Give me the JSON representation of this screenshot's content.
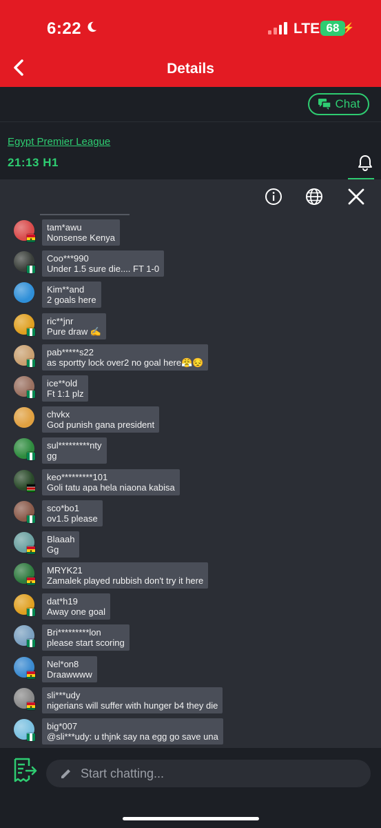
{
  "status_bar": {
    "time": "6:22",
    "network": "LTE",
    "battery": "68"
  },
  "nav": {
    "title": "Details"
  },
  "chat_button": {
    "label": "Chat"
  },
  "match": {
    "league": "Egypt Premier League",
    "time_status": "21:13 H1"
  },
  "messages": [
    {
      "name": "tam*awu",
      "text": "Nonsense Kenya",
      "avatar_color": "#d94a4a",
      "flag": "ghana"
    },
    {
      "name": "Coo***990",
      "text": "Under 1.5 sure die.... FT 1-0",
      "avatar_color": "#3a3f3a",
      "flag": "nigeria"
    },
    {
      "name": "Kim**and",
      "text": "2 goals here",
      "avatar_color": "#2f8fd8",
      "flag": "none"
    },
    {
      "name": "ric**jnr",
      "text": "Pure draw ✍",
      "avatar_color": "#e0a020",
      "flag": "nigeria"
    },
    {
      "name": "pab*****s22",
      "text": "as sportty lock over2 no goal here😤😔",
      "avatar_color": "#c9a070",
      "flag": "nigeria"
    },
    {
      "name": "ice**old",
      "text": "Ft 1:1 plz",
      "avatar_color": "#9a7060",
      "flag": "nigeria"
    },
    {
      "name": "chvkx",
      "text": "God punish gana president",
      "avatar_color": "#e0a040",
      "flag": "none"
    },
    {
      "name": "sul*********nty",
      "text": "gg",
      "avatar_color": "#2e8b3e",
      "flag": "nigeria"
    },
    {
      "name": "keo*********101",
      "text": "Goli tatu apa hela niaona kabisa",
      "avatar_color": "#2a4a2a",
      "flag": "kenya"
    },
    {
      "name": "sco*bo1",
      "text": "ov1.5 please",
      "avatar_color": "#8a5a4a",
      "flag": "nigeria"
    },
    {
      "name": "Blaaah",
      "text": "Gg",
      "avatar_color": "#6aa0a0",
      "flag": "ghana"
    },
    {
      "name": "MRYK21",
      "text": "Zamalek played rubbish don't try it here",
      "avatar_color": "#2e7a3e",
      "flag": "ghana"
    },
    {
      "name": "dat*h19",
      "text": "Away one goal",
      "avatar_color": "#e0a020",
      "flag": "nigeria"
    },
    {
      "name": "Bri*********lon",
      "text": "please start scoring",
      "avatar_color": "#7aa0c0",
      "flag": "nigeria"
    },
    {
      "name": "Nel*on8",
      "text": "Draawwww",
      "avatar_color": "#3a8ad0",
      "flag": "ghana"
    },
    {
      "name": "sli***udy",
      "text": "nigerians will suffer with hunger b4 they die",
      "avatar_color": "#8a8a8a",
      "flag": "ghana"
    },
    {
      "name": "big*007",
      "text": "@sli***udy: u thjnk say na egg go save una",
      "avatar_color": "#7ac0e0",
      "flag": "nigeria"
    }
  ],
  "input": {
    "placeholder": "Start chatting..."
  },
  "colors": {
    "brand_red": "#e31b23",
    "accent_green": "#2ecc71",
    "bubble": "#4a4e58",
    "panel": "#2b2e35",
    "background": "#1c1f25"
  },
  "icons": [
    "moon-icon",
    "signal-icon",
    "battery-icon",
    "back-icon",
    "chat-icon",
    "bell-icon",
    "info-icon",
    "globe-icon",
    "close-icon",
    "betslip-icon",
    "pencil-icon"
  ]
}
